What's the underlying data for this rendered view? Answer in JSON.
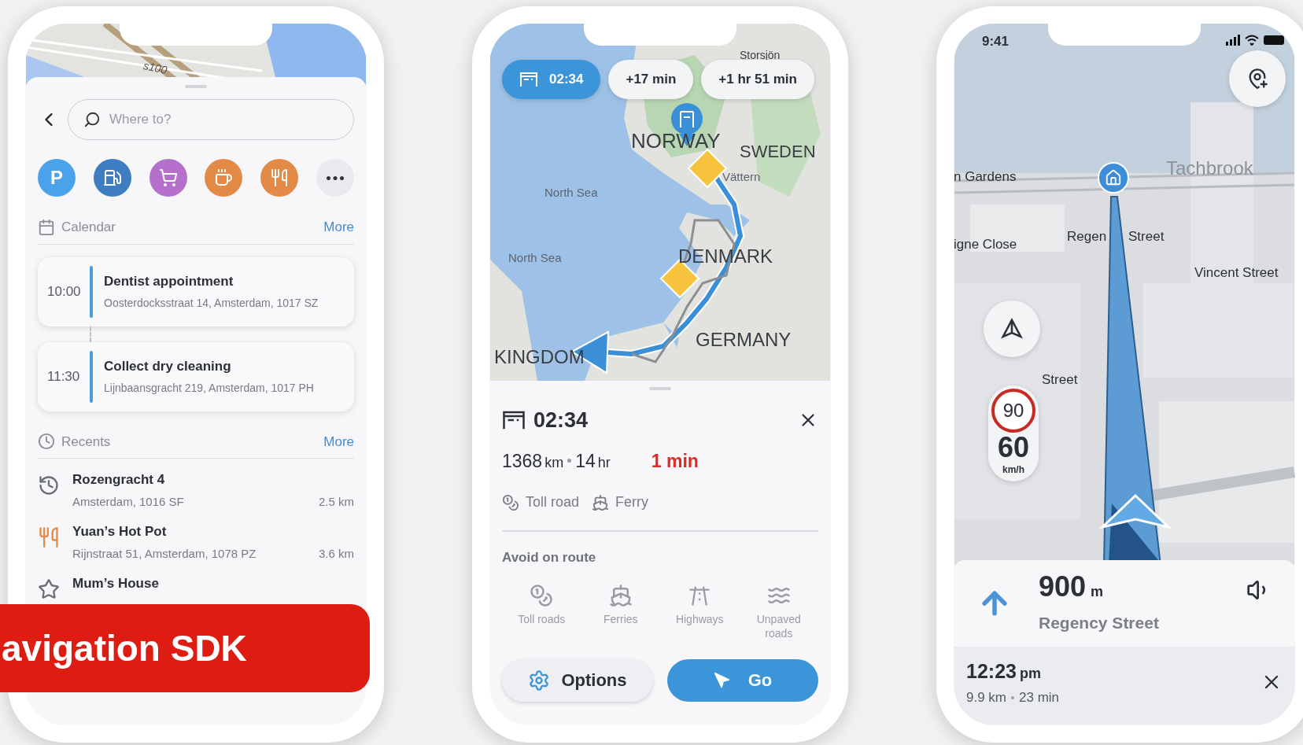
{
  "search_screen": {
    "map_labels": [
      "s100"
    ],
    "search": {
      "placeholder": "Where to?"
    },
    "categories": [
      {
        "kind": "parking",
        "label": "P",
        "color": "#4aa3ea"
      },
      {
        "kind": "fuel",
        "color": "#3d7dc0"
      },
      {
        "kind": "shopping",
        "color": "#b470cb"
      },
      {
        "kind": "cafe",
        "color": "#e48a47"
      },
      {
        "kind": "restaurant",
        "color": "#e48a47"
      },
      {
        "kind": "more",
        "color": "#e9eaee"
      }
    ],
    "calendar": {
      "title": "Calendar",
      "more": "More",
      "events": [
        {
          "time": "10:00",
          "title": "Dentist appointment",
          "address": "Oosterdocksstraat 14, Amsterdam, 1017 SZ"
        },
        {
          "time": "11:30",
          "title": "Collect dry cleaning",
          "address": "Lijnbaansgracht 219, Amsterdam, 1017 PH"
        }
      ]
    },
    "recents": {
      "title": "Recents",
      "more": "More",
      "items": [
        {
          "kind": "history",
          "name": "Rozengracht 4",
          "address": "Amsterdam, 1016 SF",
          "distance": "2.5 km"
        },
        {
          "kind": "restaurant",
          "name": "Yuan’s Hot Pot",
          "address": "Rijnstraat 51, Amsterdam, 1078 PZ",
          "distance": "3.6 km"
        },
        {
          "kind": "favorite",
          "name": "Mum’s House"
        }
      ]
    }
  },
  "banner": {
    "text": "avigation SDK"
  },
  "route_screen": {
    "route_chips": [
      {
        "label": "02:34",
        "selected": true
      },
      {
        "label": "+17 min",
        "selected": false
      },
      {
        "label": "+1 hr 51 min",
        "selected": false
      }
    ],
    "map_labels": [
      "Storsjön",
      "NORWAY",
      "SWEDEN",
      "Vättern",
      "North Sea",
      "North Sea",
      "DENMARK",
      "GERMANY",
      "KINGDOM"
    ],
    "summary": {
      "eta": "02:34",
      "distance": "1368",
      "distance_unit": "km",
      "duration": "14",
      "duration_unit": "hr",
      "delay": "1 min",
      "features": [
        {
          "kind": "toll",
          "label": "Toll road"
        },
        {
          "kind": "ferry",
          "label": "Ferry"
        }
      ]
    },
    "avoid": {
      "title": "Avoid on route",
      "options": [
        {
          "kind": "toll",
          "label": "Toll roads"
        },
        {
          "kind": "ferry",
          "label": "Ferries"
        },
        {
          "kind": "highway",
          "label": "Highways"
        },
        {
          "kind": "unpaved",
          "label": "Unpaved roads"
        }
      ]
    },
    "buttons": {
      "options": "Options",
      "go": "Go"
    }
  },
  "guidance_screen": {
    "status_time": "9:41",
    "map_labels": [
      "n Gardens",
      "Tachbrook",
      "Regen",
      "Street",
      "igne Close",
      "Vincent Street",
      "Street"
    ],
    "speed_limit": "90",
    "speed": "60",
    "speed_unit": "km/h",
    "instruction": {
      "distance": "900",
      "unit": "m",
      "street": "Regency Street"
    },
    "arrival": {
      "time": "12:23",
      "suffix": "pm",
      "distance": "9.9 km",
      "duration": "23 min"
    }
  }
}
